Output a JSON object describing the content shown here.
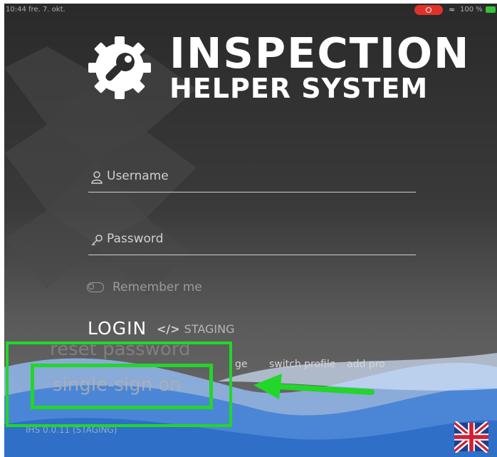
{
  "status_bar": {
    "time": "10:44",
    "date": "fre. 7. okt.",
    "battery": "100 %"
  },
  "brand": {
    "line1": "INSPECTION",
    "line2": "HELPER SYSTEM",
    "logo_icon": "gear-wrench-icon"
  },
  "form": {
    "username_placeholder": "Username",
    "password_placeholder": "Password",
    "remember_label": "Remember me",
    "login_label": "LOGIN",
    "staging_label": "STAGING",
    "staging_icon": "</>"
  },
  "links": {
    "reset_password": "reset password",
    "manage": "ge",
    "switch_profile": "switch profile",
    "add_profile": "add pro",
    "single_sign_on": "single-sign on"
  },
  "version_text": "IHS 0.0.11 (STAGING)",
  "colors": {
    "highlight": "#22d62a",
    "record": "#e0322a",
    "battery": "#36c23a"
  },
  "language_icon": "uk-flag-icon"
}
